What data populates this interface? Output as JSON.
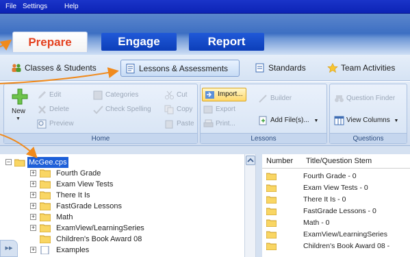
{
  "menu": {
    "file": "File",
    "settings": "Settings",
    "help": "Help"
  },
  "tabs": {
    "prepare": "Prepare",
    "engage": "Engage",
    "report": "Report"
  },
  "subtabs": {
    "classes": "Classes & Students",
    "lessons": "Lessons & Assessments",
    "standards": "Standards",
    "team": "Team Activities"
  },
  "ribbon": {
    "home": {
      "label": "Home",
      "new": "New",
      "edit": "Edit",
      "delete": "Delete",
      "preview": "Preview",
      "categories": "Categories",
      "check_spelling": "Check Spelling",
      "cut": "Cut",
      "copy": "Copy",
      "paste": "Paste"
    },
    "lessons": {
      "label": "Lessons",
      "import": "Import...",
      "export": "Export",
      "print": "Print...",
      "builder": "Builder",
      "add_files": "Add File(s)..."
    },
    "questions": {
      "label": "Questions",
      "question_finder": "Question Finder",
      "view_columns": "View Columns"
    }
  },
  "tree": {
    "root": "McGee.cps",
    "items": [
      "Fourth Grade",
      "Exam View Tests",
      "There It Is",
      "FastGrade Lessons",
      "Math",
      "ExamView/LearningSeries",
      "Children's Book Award 08",
      "Examples"
    ]
  },
  "table": {
    "columns": {
      "number": "Number",
      "title": "Title/Question Stem"
    },
    "rows": [
      "Fourth Grade - 0",
      "Exam View Tests - 0",
      "There It Is - 0",
      "FastGrade Lessons - 0",
      "Math - 0",
      "ExamView/LearningSeries",
      "Children's Book Award 08 -"
    ]
  },
  "colors": {
    "accent": "#e4411f",
    "menubar": "#1a34c9",
    "selection": "#1d5fd8",
    "annotation": "#f08a1c"
  }
}
